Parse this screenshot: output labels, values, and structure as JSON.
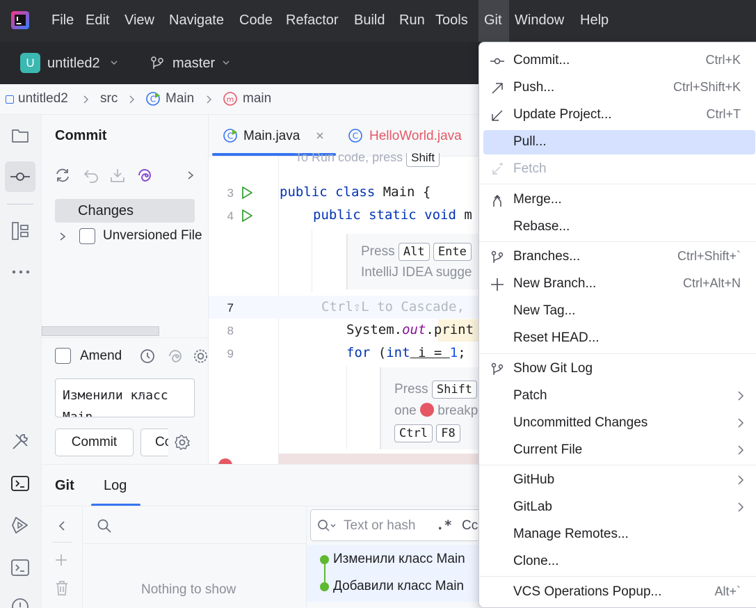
{
  "menubar": {
    "items": [
      "File",
      "Edit",
      "View",
      "Navigate",
      "Code",
      "Refactor",
      "Build",
      "Run",
      "Tools",
      "Git",
      "Window",
      "Help"
    ]
  },
  "toolbar": {
    "project_initial": "U",
    "project": "untitled2",
    "branch": "master"
  },
  "breadcrumb": [
    "untitled2",
    "src",
    "Main",
    "main"
  ],
  "commit_panel": {
    "title": "Commit",
    "changes_label": "Changes",
    "unversioned_label": "Unversioned File",
    "amend_label": "Amend",
    "message": "Изменили класс Main",
    "commit_button": "Commit",
    "commit_push_button": "Co"
  },
  "editor": {
    "tabs": [
      {
        "label": "Main.java"
      },
      {
        "label": "HelloWorld.java"
      }
    ],
    "hint_top": "To Run code, press",
    "hint_top_key": "Shift",
    "line_numbers": [
      "3",
      "4",
      "7",
      "8",
      "9"
    ],
    "line3": {
      "kw": "public class",
      "rest": " Main {"
    },
    "line4": {
      "kw": "public static void",
      "rest": " m"
    },
    "hint1": {
      "press": "Press",
      "key1": "Alt",
      "key2": "Ente",
      "line2": "IntelliJ IDEA sugge"
    },
    "line7": "Ctrl⇧L to Cascade,",
    "line8": {
      "pre": "System.",
      "italic": "out",
      "post": ".print"
    },
    "line9": {
      "kw1": "for",
      "mid": " (",
      "kw2": "int",
      "rest": " i = ",
      "num": "1",
      "end": ";"
    },
    "hint2": {
      "press": "Press",
      "key1": "Shift",
      "one": "one",
      "breakp": "breakp",
      "key2": "Ctrl",
      "key3": "F8"
    }
  },
  "bottom_panel": {
    "tab_git": "Git",
    "tab_log": "Log",
    "search_placeholder": "Text or hash",
    "regex": ".*",
    "cc": "Cc",
    "nothing": "Nothing to show",
    "commits": [
      "Изменили класс Main",
      "Добавили класс Main"
    ]
  },
  "git_menu": {
    "items": [
      {
        "label": "Commit...",
        "shortcut": "Ctrl+K",
        "icon": "commit-icon"
      },
      {
        "label": "Push...",
        "shortcut": "Ctrl+Shift+K",
        "icon": "push-icon"
      },
      {
        "label": "Update Project...",
        "shortcut": "Ctrl+T",
        "icon": "update-icon"
      },
      {
        "label": "Pull...",
        "shortcut": "",
        "icon": ""
      },
      {
        "label": "Fetch",
        "shortcut": "",
        "icon": "fetch-icon",
        "disabled": true
      },
      {
        "label": "Merge...",
        "shortcut": "",
        "icon": "merge-icon"
      },
      {
        "label": "Rebase...",
        "shortcut": "",
        "icon": ""
      },
      {
        "label": "Branches...",
        "shortcut": "Ctrl+Shift+`",
        "icon": "branch-icon"
      },
      {
        "label": "New Branch...",
        "shortcut": "Ctrl+Alt+N",
        "icon": "plus-icon"
      },
      {
        "label": "New Tag...",
        "shortcut": "",
        "icon": ""
      },
      {
        "label": "Reset HEAD...",
        "shortcut": "",
        "icon": ""
      },
      {
        "label": "Show Git Log",
        "shortcut": "",
        "icon": "branch-icon"
      },
      {
        "label": "Patch",
        "shortcut": "",
        "icon": "",
        "submenu": true
      },
      {
        "label": "Uncommitted Changes",
        "shortcut": "",
        "icon": "",
        "submenu": true
      },
      {
        "label": "Current File",
        "shortcut": "",
        "icon": "",
        "submenu": true
      },
      {
        "label": "GitHub",
        "shortcut": "",
        "icon": "",
        "submenu": true
      },
      {
        "label": "GitLab",
        "shortcut": "",
        "icon": "",
        "submenu": true
      },
      {
        "label": "Manage Remotes...",
        "shortcut": "",
        "icon": ""
      },
      {
        "label": "Clone...",
        "shortcut": "",
        "icon": ""
      },
      {
        "label": "VCS Operations Popup...",
        "shortcut": "Alt+`",
        "icon": ""
      }
    ],
    "highlighted": "Pull..."
  },
  "colors": {
    "menubar_bg": "#2b2d30",
    "highlight": "#d5e1ff",
    "accent": "#3574f0",
    "commit_dot": "#5fb832",
    "breakpoint": "#e55765"
  }
}
